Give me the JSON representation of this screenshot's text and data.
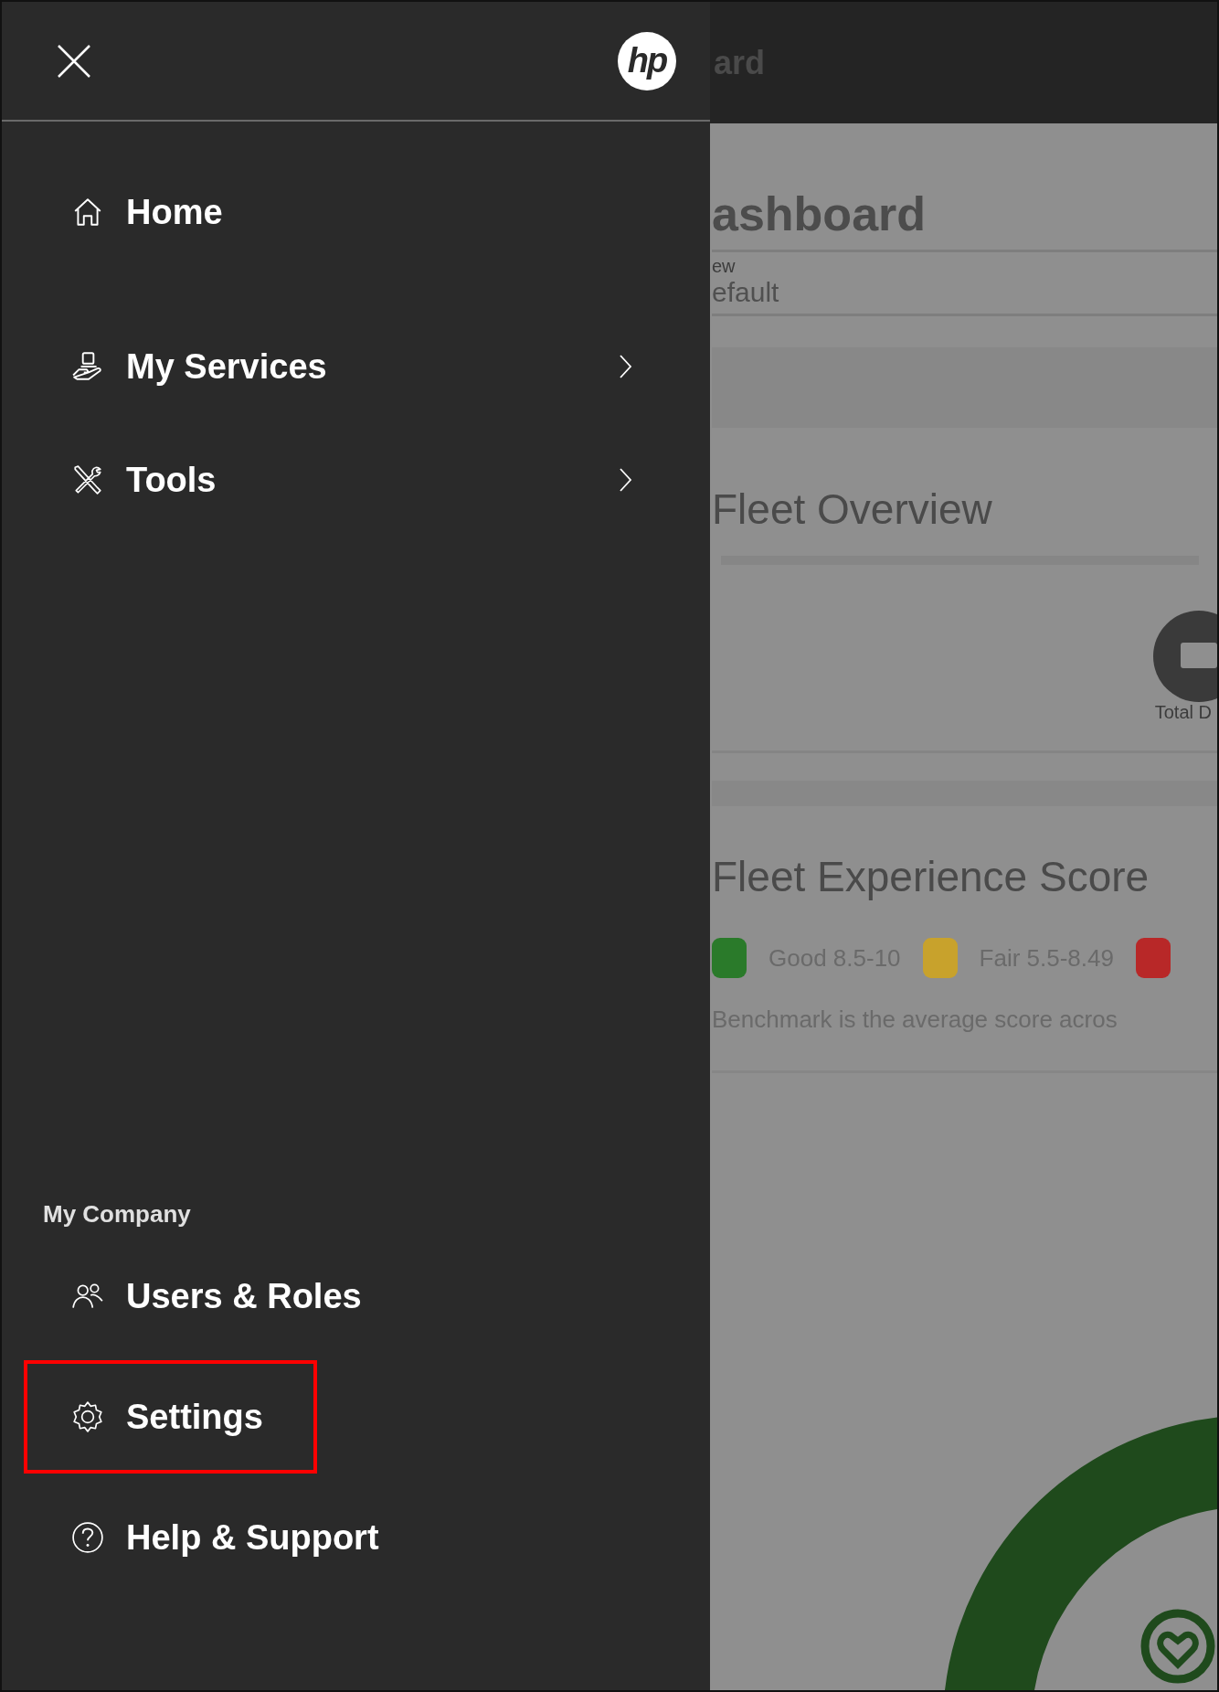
{
  "menu": {
    "logo": "hp",
    "items": [
      {
        "label": "Home",
        "kind": "home",
        "has_submenu": false,
        "highlighted": false
      },
      {
        "label": "My Services",
        "kind": "services",
        "has_submenu": true,
        "highlighted": false
      },
      {
        "label": "Tools",
        "kind": "tools",
        "has_submenu": true,
        "highlighted": false
      }
    ],
    "section": {
      "title": "My Company",
      "items": [
        {
          "label": "Users & Roles",
          "kind": "users",
          "has_submenu": false,
          "highlighted": false
        },
        {
          "label": "Settings",
          "kind": "settings",
          "has_submenu": false,
          "highlighted": true
        },
        {
          "label": "Help & Support",
          "kind": "help",
          "has_submenu": false,
          "highlighted": false
        }
      ]
    }
  },
  "background_page": {
    "top_bar_title": "ard",
    "page_title": "ashboard",
    "view_label": "ew",
    "view_value": "efault",
    "fleet_overview": {
      "title": "Fleet Overview",
      "tile_label": "Total D"
    },
    "fleet_experience": {
      "title": "Fleet Experience Score",
      "legend": [
        {
          "label": "Good 8.5-10",
          "color": "#2a7a2a"
        },
        {
          "label": "Fair 5.5-8.49",
          "color": "#c8a22c"
        },
        {
          "color": "#b82828"
        }
      ],
      "note": "Benchmark is the average score acros"
    }
  }
}
